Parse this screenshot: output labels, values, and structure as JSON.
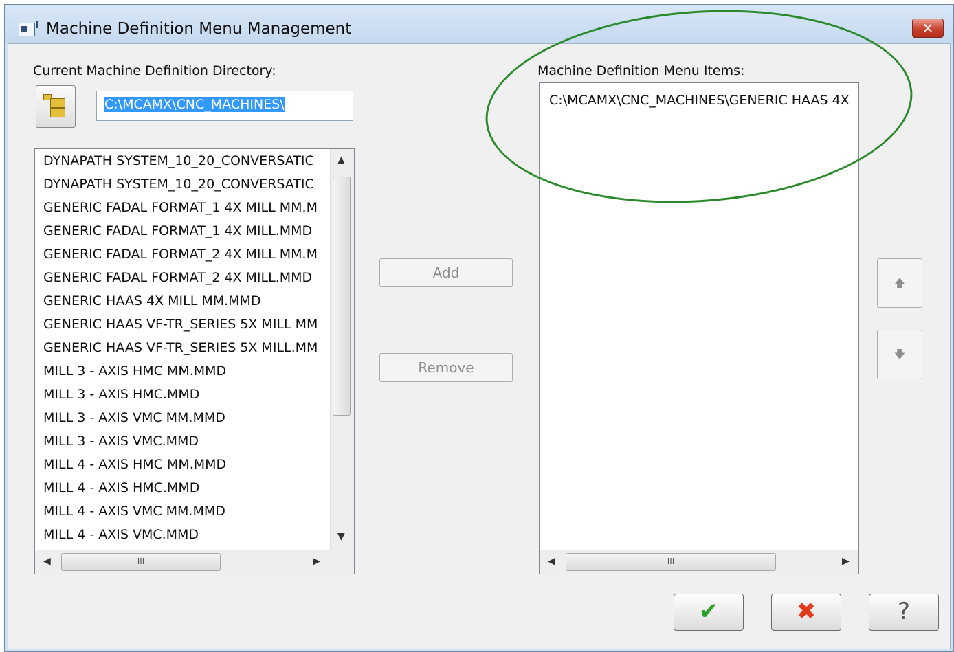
{
  "window": {
    "title": "Machine Definition Menu Management",
    "close_label": "✕"
  },
  "left_panel": {
    "label": "Current Machine Definition Directory:",
    "directory_value": "C:\\MCAMX\\CNC_MACHINES\\",
    "files": [
      "DYNAPATH SYSTEM_10_20_CONVERSATIC",
      "DYNAPATH SYSTEM_10_20_CONVERSATIC",
      "GENERIC FADAL FORMAT_1 4X MILL MM.M",
      "GENERIC FADAL FORMAT_1 4X MILL.MMD",
      "GENERIC FADAL FORMAT_2 4X MILL MM.M",
      "GENERIC FADAL FORMAT_2 4X MILL.MMD",
      "GENERIC HAAS 4X MILL MM.MMD",
      "GENERIC HAAS VF-TR_SERIES 5X MILL MM",
      "GENERIC HAAS VF-TR_SERIES 5X MILL.MM",
      "MILL 3 - AXIS HMC MM.MMD",
      "MILL 3 - AXIS HMC.MMD",
      "MILL 3 - AXIS VMC MM.MMD",
      "MILL 3 - AXIS VMC.MMD",
      "MILL 4 - AXIS HMC MM.MMD",
      "MILL 4 - AXIS HMC.MMD",
      "MILL 4 - AXIS VMC MM.MMD",
      "MILL 4 - AXIS VMC.MMD"
    ],
    "scroll_grip": "III"
  },
  "middle": {
    "add_label": "Add",
    "remove_label": "Remove"
  },
  "right_panel": {
    "label": "Machine Definition Menu Items:",
    "items": [
      "C:\\MCAMX\\CNC_MACHINES\\GENERIC HAAS 4X"
    ],
    "scroll_grip": "III"
  },
  "order": {
    "up_label": "🡅",
    "down_label": "🡇"
  },
  "actions": {
    "ok_label": "✔",
    "cancel_label": "✖",
    "help_label": "?"
  },
  "colors": {
    "selection": "#3399ff",
    "annotation": "#2b8a2b"
  }
}
